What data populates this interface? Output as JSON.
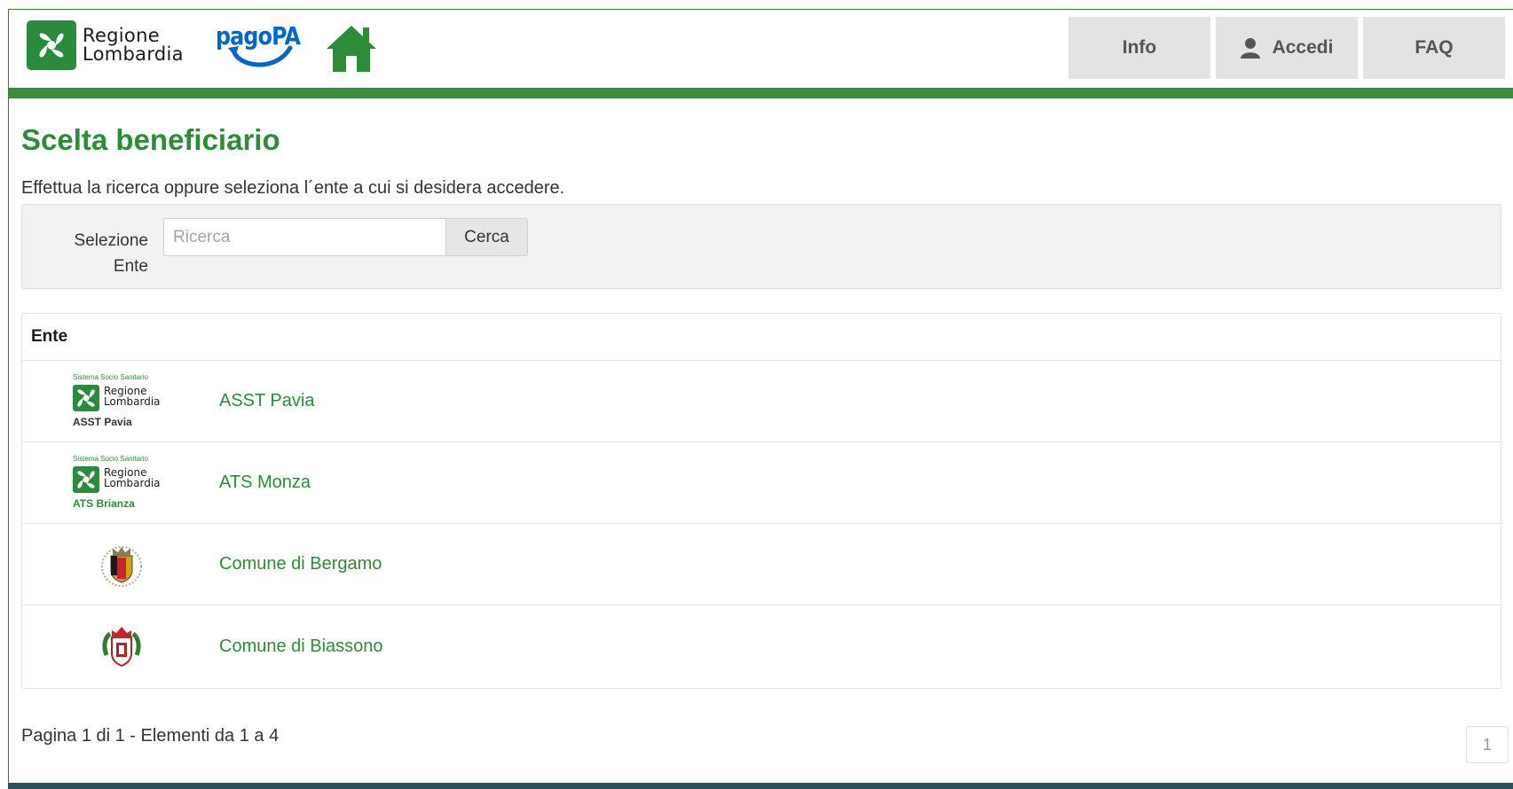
{
  "header": {
    "logo_text_line1": "Regione",
    "logo_text_line2": "Lombardia",
    "pagopa_text": "pagoPA",
    "nav": {
      "info": "Info",
      "accedi": "Accedi",
      "faq": "FAQ"
    }
  },
  "main": {
    "title": "Scelta beneficiario",
    "intro": "Effettua la ricerca oppure seleziona l´ente a cui si desidera accedere.",
    "search": {
      "label_line1": "Selezione",
      "label_line2": "Ente",
      "placeholder": "Ricerca",
      "value": "",
      "button": "Cerca"
    },
    "table": {
      "header": "Ente",
      "rows": [
        {
          "name": "ASST Pavia",
          "logo": {
            "top": "Sistema Socio Sanitario",
            "line1": "Regione",
            "line2": "Lombardia",
            "sub": "ASST Pavia"
          }
        },
        {
          "name": "ATS Monza",
          "logo": {
            "top": "Sistema Socio Sanitario",
            "line1": "Regione",
            "line2": "Lombardia",
            "sub": "ATS Brianza"
          }
        },
        {
          "name": "Comune di Bergamo",
          "logo": "bergamo-coat-of-arms-icon"
        },
        {
          "name": "Comune di Biassono",
          "logo": "biassono-coat-of-arms-icon"
        }
      ]
    },
    "pagination": {
      "summary": "Pagina 1 di 1 - Elementi da 1 a 4",
      "current_page": "1"
    }
  },
  "colors": {
    "brand_green": "#2e8b3a",
    "header_bar": "#3c8c3e",
    "nav_bg": "#e3e3e3",
    "pagopa_blue": "#0066cc",
    "footer": "#2f4f5f"
  }
}
